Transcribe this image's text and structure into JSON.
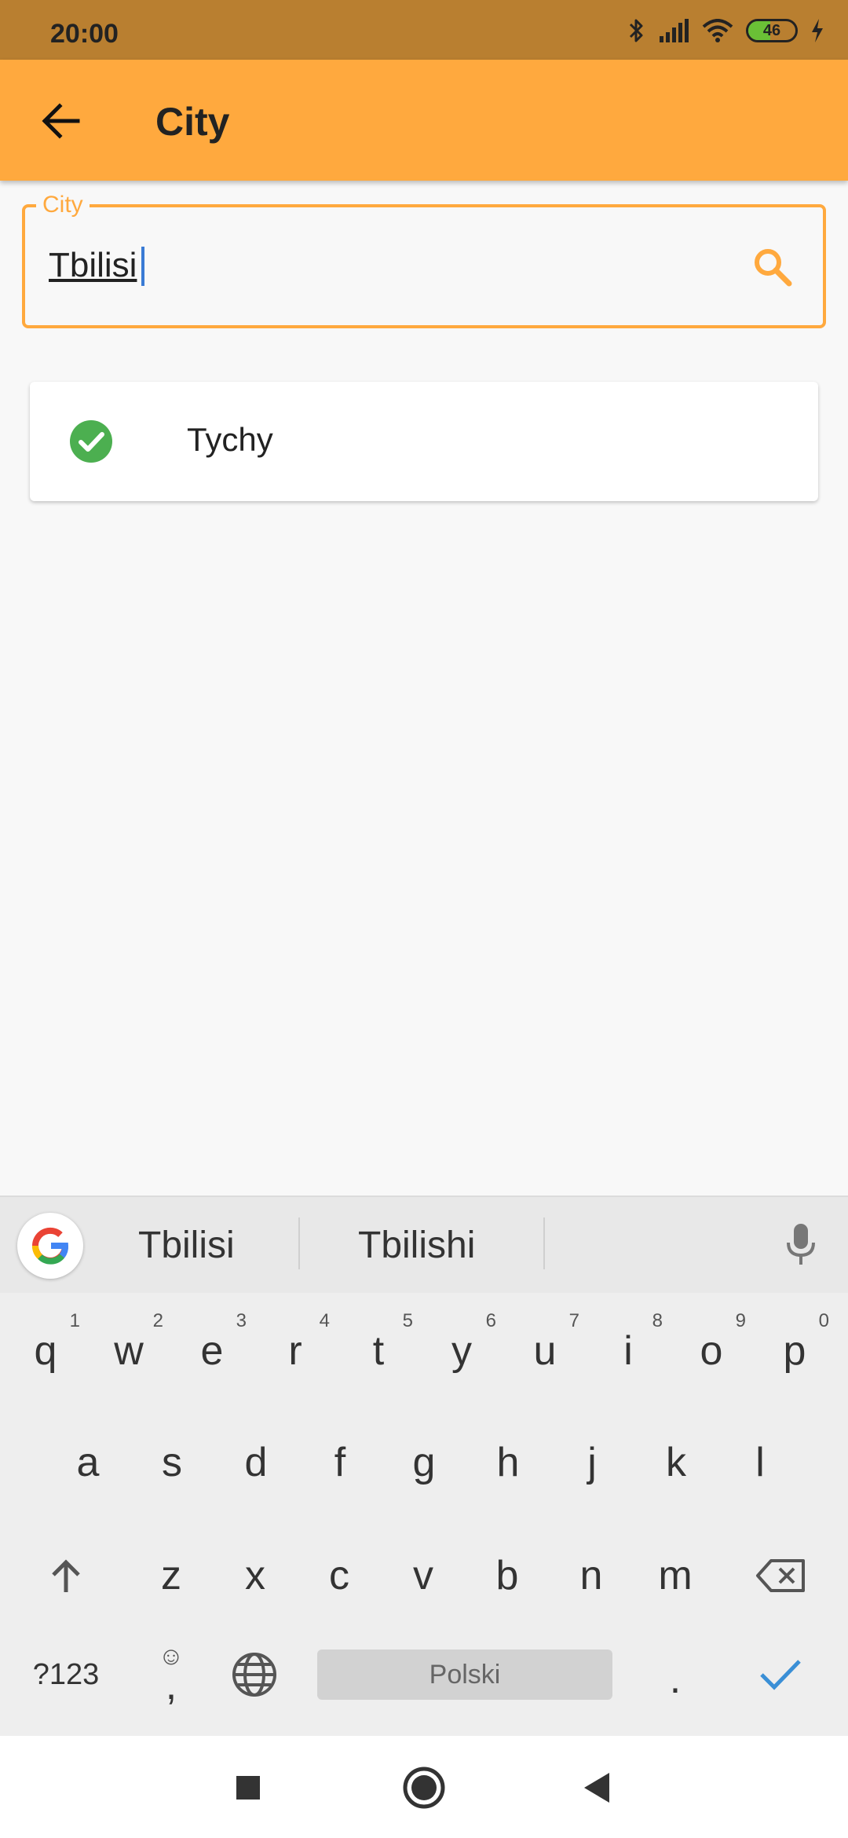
{
  "status": {
    "time": "20:00",
    "battery": "46",
    "battery_level_percent": 46
  },
  "app_bar": {
    "title": "City",
    "back_icon": "arrow-left-icon"
  },
  "search": {
    "label": "City",
    "value": "Tbilisi",
    "accent_color": "#ffa93e",
    "search_icon": "search-icon"
  },
  "results": [
    {
      "label": "Tychy",
      "icon": "check-circle-icon",
      "icon_color": "#4caf50"
    }
  ],
  "keyboard": {
    "suggestions": [
      "Tbilisi",
      "Tbilishi"
    ],
    "row1": [
      {
        "key": "q",
        "hint": "1"
      },
      {
        "key": "w",
        "hint": "2"
      },
      {
        "key": "e",
        "hint": "3"
      },
      {
        "key": "r",
        "hint": "4"
      },
      {
        "key": "t",
        "hint": "5"
      },
      {
        "key": "y",
        "hint": "6"
      },
      {
        "key": "u",
        "hint": "7"
      },
      {
        "key": "i",
        "hint": "8"
      },
      {
        "key": "o",
        "hint": "9"
      },
      {
        "key": "p",
        "hint": "0"
      }
    ],
    "row2": [
      "a",
      "s",
      "d",
      "f",
      "g",
      "h",
      "j",
      "k",
      "l"
    ],
    "row3": [
      "z",
      "x",
      "c",
      "v",
      "b",
      "n",
      "m"
    ],
    "symbols_label": "?123",
    "comma_label": ",",
    "space_label": "Polski",
    "period_label": ".",
    "enter_color": "#3a8fd6"
  }
}
